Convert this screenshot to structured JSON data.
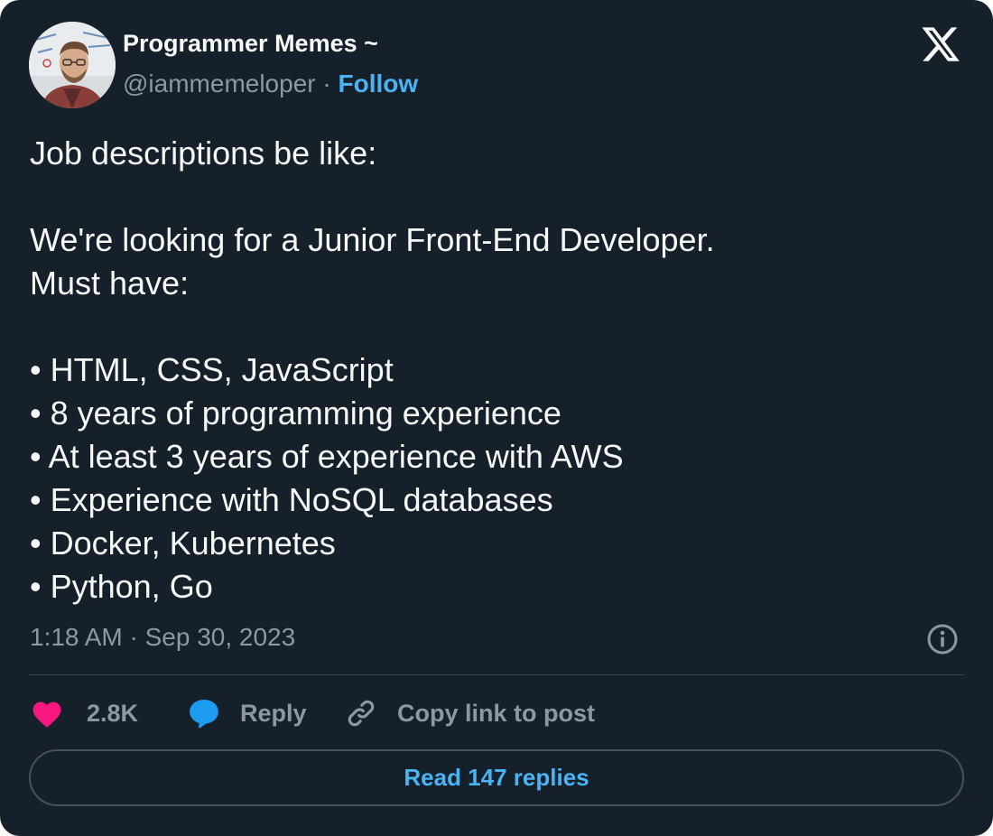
{
  "author": {
    "name": "Programmer Memes ~",
    "handle": "@iammemeloper",
    "separator": "·",
    "follow_label": "Follow",
    "avatar_icon": "avatar-photo"
  },
  "brand_icon": "x-logo-icon",
  "tweet": {
    "lines": [
      "Job descriptions be like:",
      "",
      "We're looking for a Junior Front-End Developer.",
      "Must have:",
      "",
      "• HTML, CSS, JavaScript",
      "• 8 years of programming experience",
      "• At least 3 years of experience with AWS",
      "• Experience with NoSQL databases",
      "• Docker, Kubernetes",
      "• Python, Go"
    ]
  },
  "meta": {
    "timestamp": "1:18 AM · Sep 30, 2023",
    "info_icon": "info-icon"
  },
  "actions": {
    "like_count": "2.8K",
    "reply_label": "Reply",
    "copy_label": "Copy link to post"
  },
  "read_replies_label": "Read 147 replies",
  "colors": {
    "background": "#15202b",
    "text": "#f7f9f9",
    "muted": "#8b98a5",
    "accent": "#4ab3f4",
    "like": "#f91880",
    "reply_icon": "#1d9bf0",
    "border": "#38444d"
  }
}
